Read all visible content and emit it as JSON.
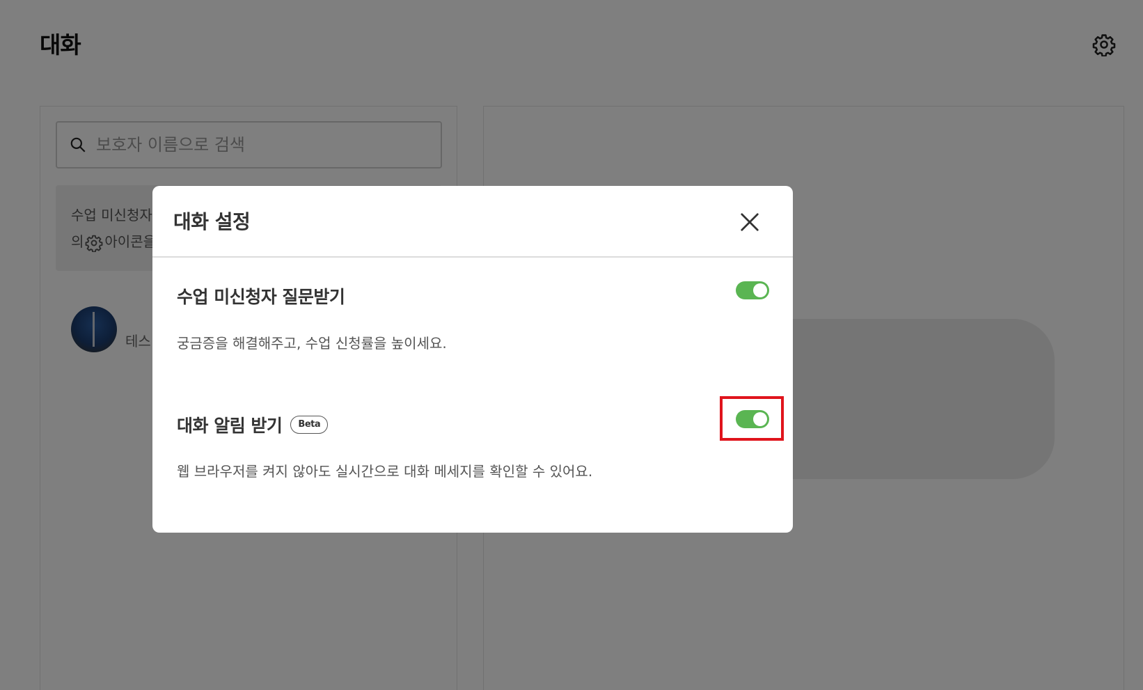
{
  "page": {
    "title": "대화",
    "settings_icon": "gear-icon"
  },
  "search": {
    "placeholder": "보호자 이름으로 검색",
    "icon": "search-icon"
  },
  "notice": {
    "line1": "수업 미신청자",
    "line2_prefix": "의",
    "line2_suffix": "아이콘을"
  },
  "chat_list": [
    {
      "name": "테스"
    }
  ],
  "modal": {
    "title": "대화 설정",
    "close_icon": "close-icon",
    "settings": [
      {
        "title": "수업 미신청자 질문받기",
        "description": "궁금증을 해결해주고, 수업 신청률을 높이세요.",
        "enabled": true
      },
      {
        "title": "대화 알림 받기",
        "badge": "Beta",
        "description": "웹 브라우저를 켜지 않아도 실시간으로 대화 메세지를 확인할 수 있어요.",
        "enabled": true
      }
    ]
  },
  "colors": {
    "toggle_on": "#5ab552",
    "highlight": "#e0141c",
    "overlay": "rgba(0,0,0,0.5)"
  }
}
